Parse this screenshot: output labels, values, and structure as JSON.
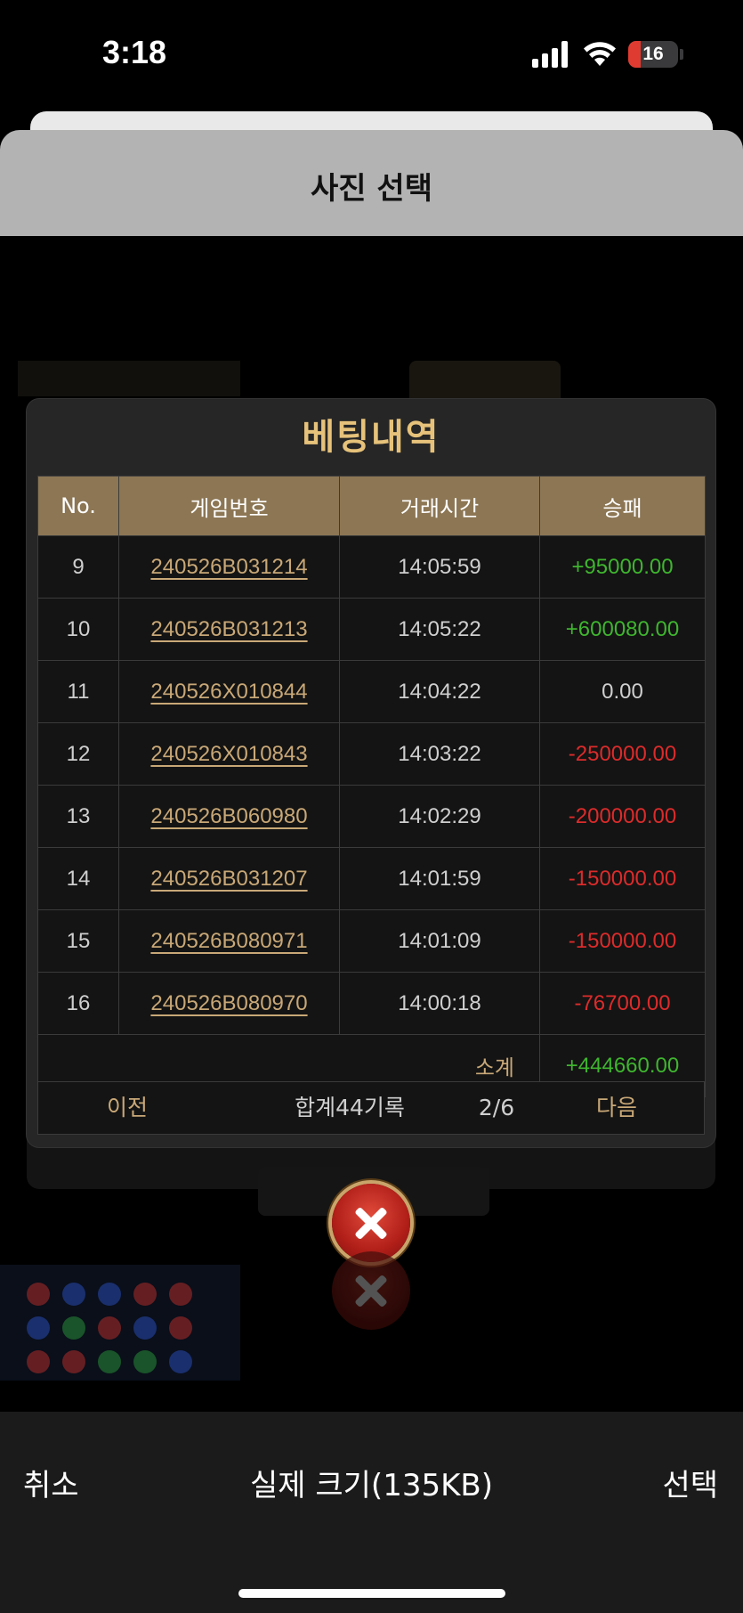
{
  "status_bar": {
    "time": "3:18",
    "battery": "16"
  },
  "header": {
    "title": "사진 선택"
  },
  "modal": {
    "title": "베팅내역",
    "columns": [
      "No.",
      "게임번호",
      "거래시간",
      "승패"
    ],
    "rows": [
      {
        "no": "9",
        "game": "240526B031214",
        "time": "14:05:59",
        "result": "+95000.00",
        "type": "pos"
      },
      {
        "no": "10",
        "game": "240526B031213",
        "time": "14:05:22",
        "result": "+600080.00",
        "type": "pos"
      },
      {
        "no": "11",
        "game": "240526X010844",
        "time": "14:04:22",
        "result": "0.00",
        "type": "zero"
      },
      {
        "no": "12",
        "game": "240526X010843",
        "time": "14:03:22",
        "result": "-250000.00",
        "type": "neg"
      },
      {
        "no": "13",
        "game": "240526B060980",
        "time": "14:02:29",
        "result": "-200000.00",
        "type": "neg"
      },
      {
        "no": "14",
        "game": "240526B031207",
        "time": "14:01:59",
        "result": "-150000.00",
        "type": "neg"
      },
      {
        "no": "15",
        "game": "240526B080971",
        "time": "14:01:09",
        "result": "-150000.00",
        "type": "neg"
      },
      {
        "no": "16",
        "game": "240526B080970",
        "time": "14:00:18",
        "result": "-76700.00",
        "type": "neg"
      }
    ],
    "subtotal": {
      "label": "소계",
      "value": "+444660.00"
    },
    "pager": {
      "prev": "이전",
      "total": "합계44기록",
      "page": "2/6",
      "next": "다음"
    }
  },
  "toolbar": {
    "cancel": "취소",
    "size": "실제 크기(135KB)",
    "select": "선택"
  },
  "colors": {
    "gold": "#c9a877",
    "positive": "#3fb52f",
    "negative": "#dc2b2b",
    "header_bg": "#8c7654"
  }
}
